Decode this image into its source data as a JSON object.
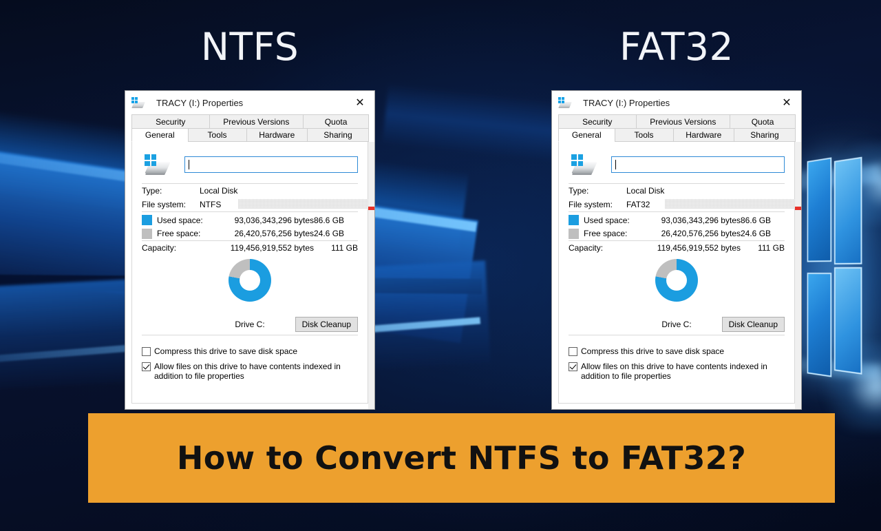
{
  "headings": {
    "left": "NTFS",
    "right": "FAT32"
  },
  "banner": {
    "text": "How to Convert NTFS to FAT32?",
    "bg_color": "#eda02e",
    "text_color": "#111111"
  },
  "colors": {
    "used_space": "#1b9de0",
    "free_space": "#bfbfbf",
    "accent_red": "#e8312a",
    "input_focus_border": "#2e8ad6"
  },
  "dialogs": [
    {
      "id": "ntfs",
      "titlebar": {
        "icon": "drive-icon",
        "title": "TRACY (I:)  Properties",
        "close_label": "✕"
      },
      "tabs_row1": [
        {
          "label": "Security",
          "active": false
        },
        {
          "label": "Previous Versions",
          "active": false
        },
        {
          "label": "Quota",
          "active": false
        }
      ],
      "tabs_row2": [
        {
          "label": "General",
          "active": true
        },
        {
          "label": "Tools",
          "active": false
        },
        {
          "label": "Hardware",
          "active": false
        },
        {
          "label": "Sharing",
          "active": false
        }
      ],
      "volume_label": {
        "value": "",
        "placeholder": ""
      },
      "info": [
        {
          "label": "Type:",
          "value": "Local Disk"
        },
        {
          "label": "File system:",
          "value": "NTFS"
        }
      ],
      "space": [
        {
          "swatch": "used",
          "label": "Used space:",
          "bytes": "93,036,343,296 bytes",
          "gb": "86.6 GB"
        },
        {
          "swatch": "free",
          "label": "Free space:",
          "bytes": "26,420,576,256 bytes",
          "gb": "24.6 GB"
        }
      ],
      "capacity": {
        "label": "Capacity:",
        "bytes": "119,456,919,552 bytes",
        "gb": "111 GB"
      },
      "drive_caption": "Drive C:",
      "cleanup_button": "Disk Cleanup",
      "checkboxes": [
        {
          "checked": false,
          "text": "Compress this drive to save disk space"
        },
        {
          "checked": true,
          "text": "Allow files on this drive to have contents indexed in addition to file properties"
        }
      ]
    },
    {
      "id": "fat32",
      "titlebar": {
        "icon": "drive-icon",
        "title": "TRACY (I:)  Properties",
        "close_label": "✕"
      },
      "tabs_row1": [
        {
          "label": "Security",
          "active": false
        },
        {
          "label": "Previous Versions",
          "active": false
        },
        {
          "label": "Quota",
          "active": false
        }
      ],
      "tabs_row2": [
        {
          "label": "General",
          "active": true
        },
        {
          "label": "Tools",
          "active": false
        },
        {
          "label": "Hardware",
          "active": false
        },
        {
          "label": "Sharing",
          "active": false
        }
      ],
      "volume_label": {
        "value": "",
        "placeholder": ""
      },
      "info": [
        {
          "label": "Type:",
          "value": "Local Disk"
        },
        {
          "label": "File system:",
          "value": "FAT32"
        }
      ],
      "space": [
        {
          "swatch": "used",
          "label": "Used space:",
          "bytes": "93,036,343,296 bytes",
          "gb": "86.6 GB"
        },
        {
          "swatch": "free",
          "label": "Free space:",
          "bytes": "26,420,576,256 bytes",
          "gb": "24.6 GB"
        }
      ],
      "capacity": {
        "label": "Capacity:",
        "bytes": "119,456,919,552 bytes",
        "gb": "111 GB"
      },
      "drive_caption": "Drive C:",
      "cleanup_button": "Disk Cleanup",
      "checkboxes": [
        {
          "checked": false,
          "text": "Compress this drive to save disk space"
        },
        {
          "checked": true,
          "text": "Allow files on this drive to have contents indexed in addition to file properties"
        }
      ]
    }
  ],
  "chart_data": {
    "type": "pie",
    "title": "Drive C:",
    "labels": [
      "Used space",
      "Free space"
    ],
    "values": [
      86.6,
      24.6
    ],
    "units": "GB",
    "percentages": [
      77.9,
      22.1
    ],
    "colors": [
      "#1b9de0",
      "#bfbfbf"
    ],
    "donut": true,
    "legend_position": "above"
  }
}
